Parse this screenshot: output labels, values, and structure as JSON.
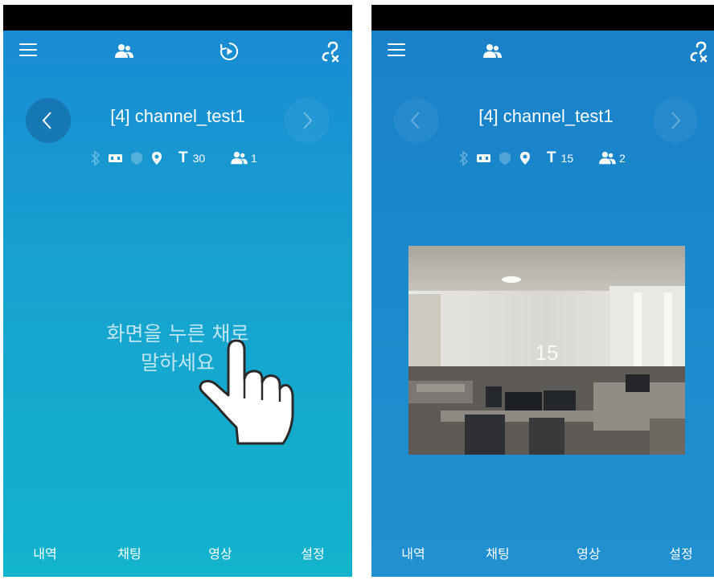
{
  "left": {
    "channel_title": "[4] channel_test1",
    "text_count_label": "T",
    "text_count": "30",
    "user_count": "1",
    "hint_line1": "화면을 누른 채로",
    "hint_line2": "말하세요"
  },
  "right": {
    "channel_title": "[4] channel_test1",
    "text_count_label": "T",
    "text_count": "15",
    "user_count": "2",
    "video_counter": "15"
  },
  "bottom_nav": [
    "내역",
    "채팅",
    "영상",
    "설정"
  ],
  "colors": {
    "left_gradient_top": "#1988d3",
    "left_gradient_bottom": "#12b4cb",
    "right_background": "#1b8bcd",
    "statusbar": "#000000",
    "icon": "#ffffff"
  },
  "icons": [
    "menu-icon",
    "users-icon",
    "replay-icon",
    "unlink-icon",
    "bluetooth-icon",
    "battery-icon",
    "shield-icon",
    "location-icon",
    "chevron-left-icon",
    "chevron-right-icon",
    "hand-pointer-icon"
  ]
}
